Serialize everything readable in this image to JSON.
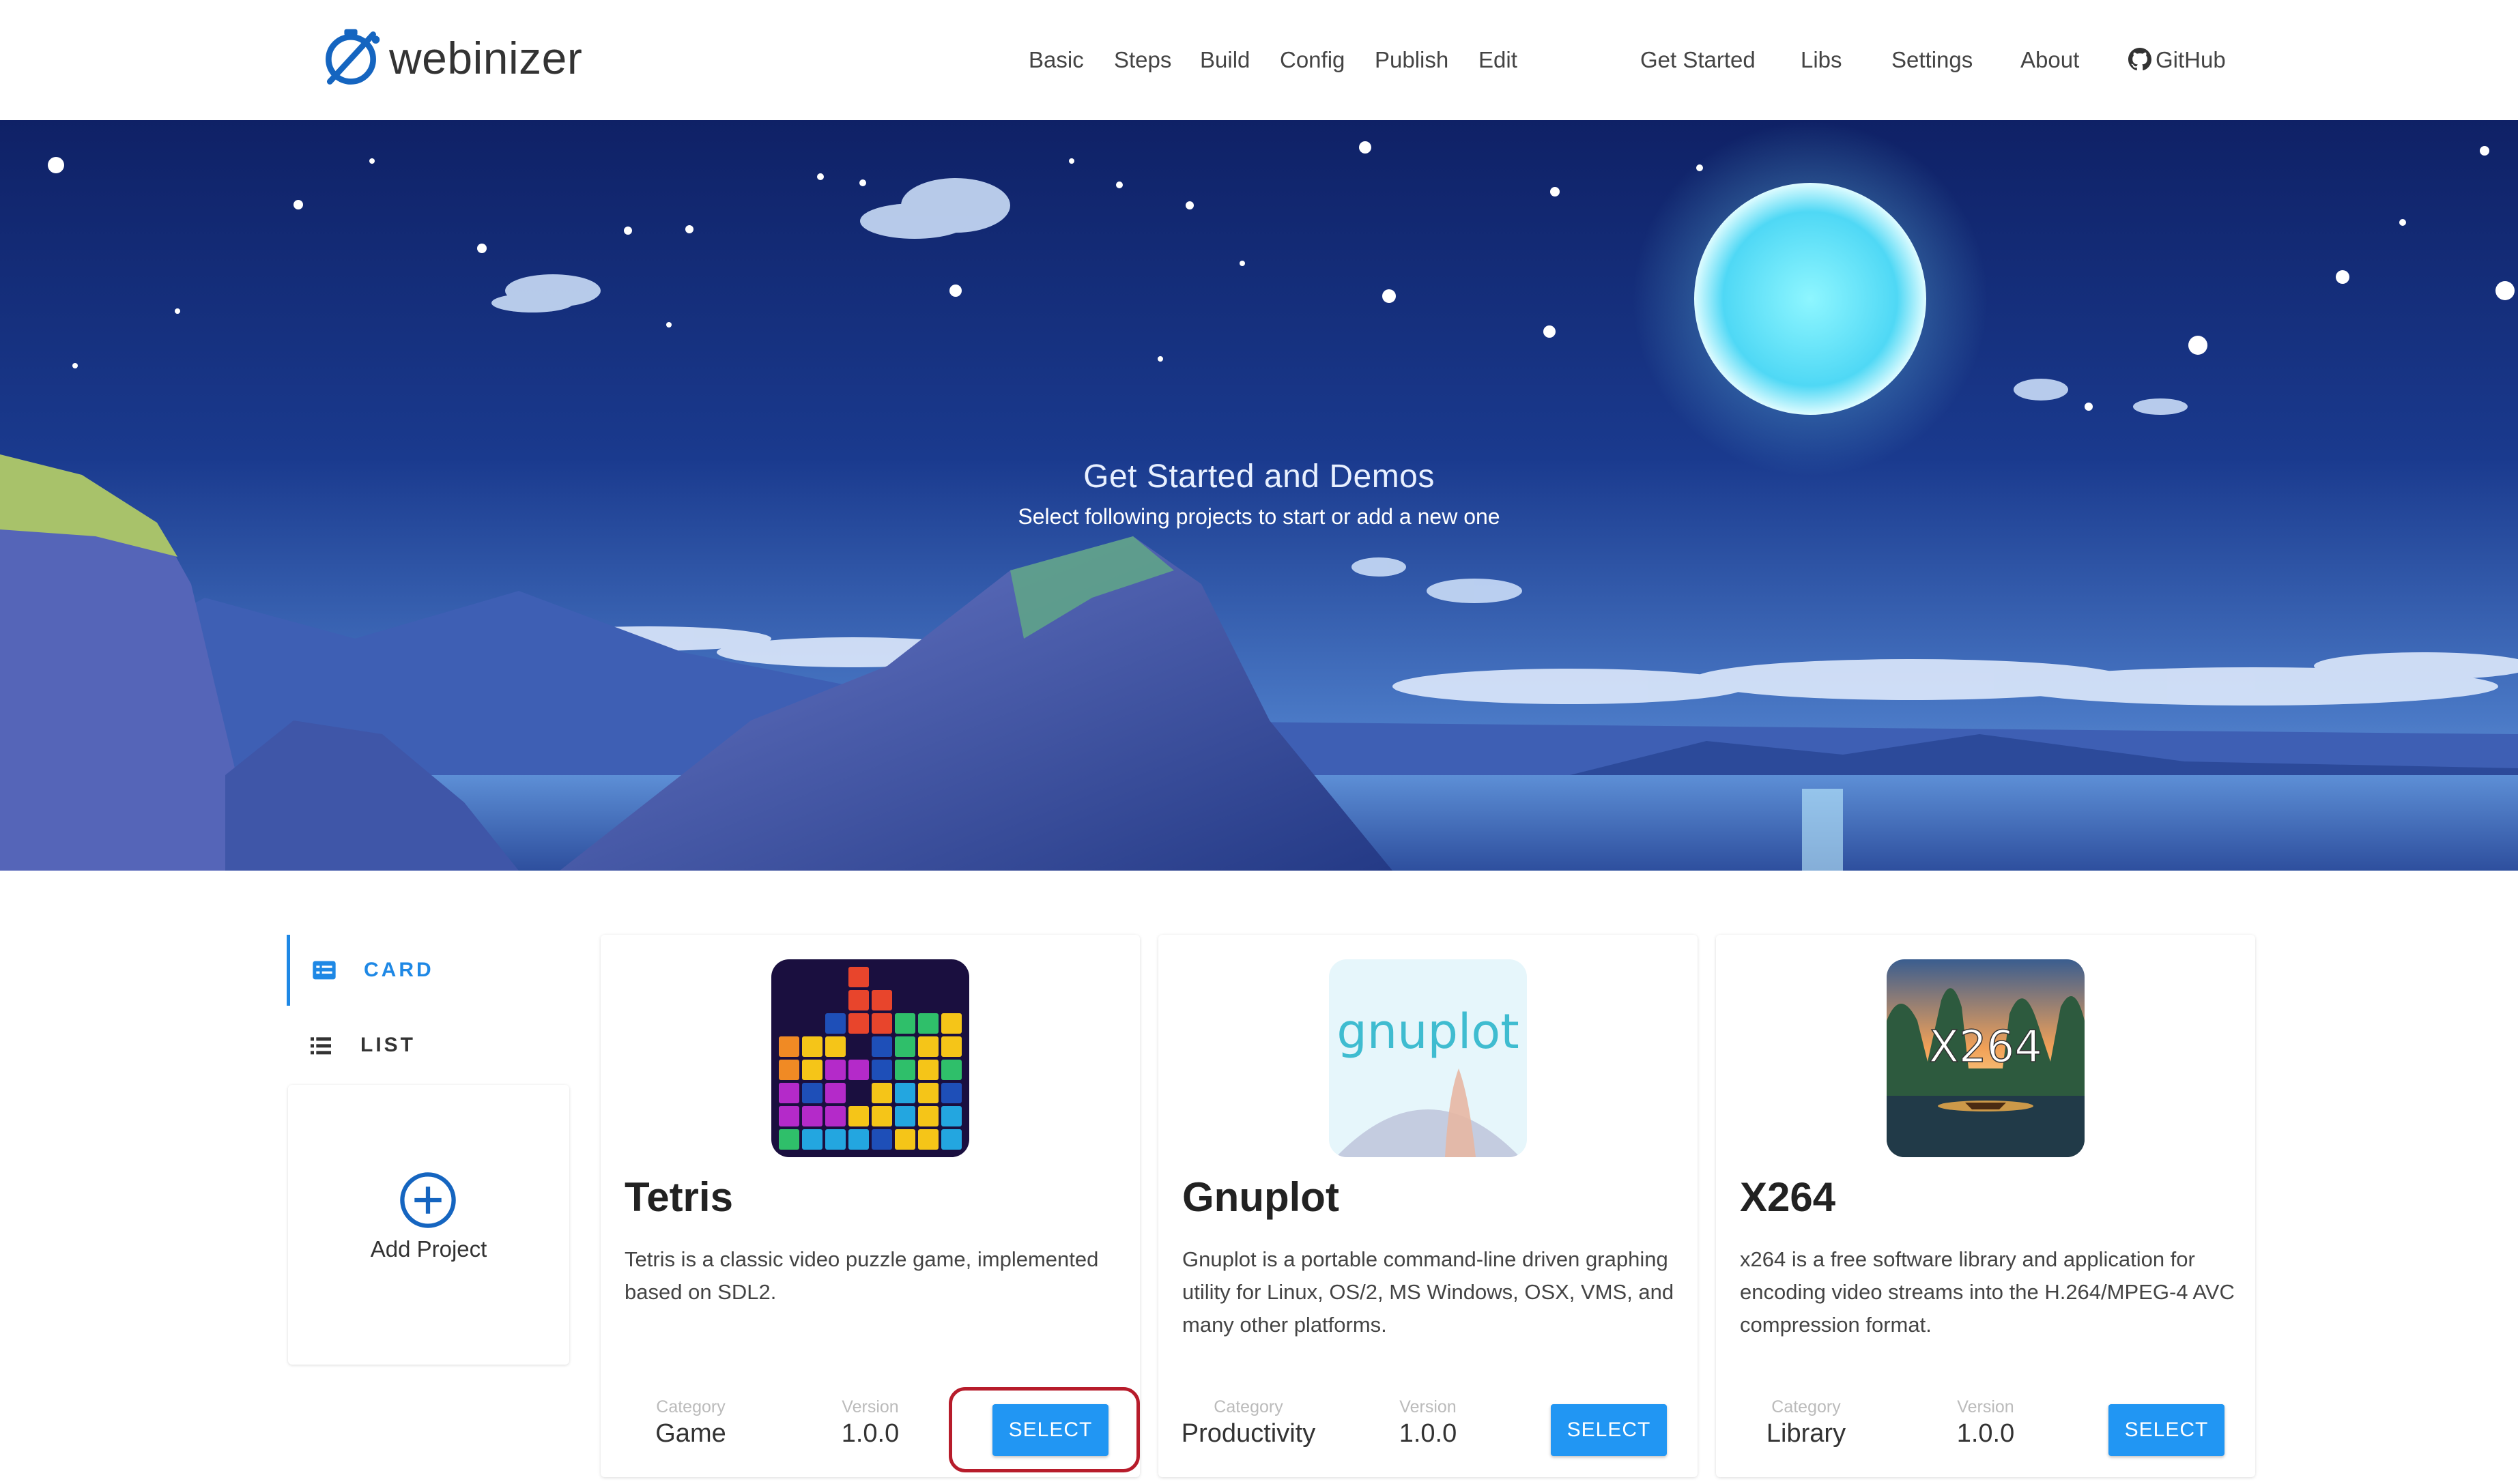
{
  "header": {
    "brand": "webinizer",
    "nav": [
      {
        "label": "Basic"
      },
      {
        "label": "Steps"
      },
      {
        "label": "Build"
      },
      {
        "label": "Config"
      },
      {
        "label": "Publish"
      },
      {
        "label": "Edit"
      },
      {
        "label": "Get Started"
      },
      {
        "label": "Libs"
      },
      {
        "label": "Settings"
      },
      {
        "label": "About"
      },
      {
        "label": "GitHub"
      }
    ]
  },
  "hero": {
    "title": "Get Started and Demos",
    "subtitle": "Select following projects to start or add a new one"
  },
  "views": {
    "card_label": "CARD",
    "list_label": "LIST",
    "active": "CARD"
  },
  "add_project": {
    "label": "Add Project"
  },
  "meta_labels": {
    "category": "Category",
    "version": "Version"
  },
  "projects": [
    {
      "name": "Tetris",
      "description": "Tetris is a classic video puzzle game, implemented based on SDL2.",
      "category": "Game",
      "version": "1.0.0",
      "button": "SELECT",
      "thumbnail": "tetris-blocks-image"
    },
    {
      "name": "Gnuplot",
      "description": "Gnuplot is a portable command-line driven graphing utility for Linux, OS/2, MS Windows, OSX, VMS, and many other platforms.",
      "category": "Productivity",
      "version": "1.0.0",
      "button": "SELECT",
      "thumbnail": "gnuplot-logo-image",
      "thumbnail_text": "gnuplot"
    },
    {
      "name": "X264",
      "description": "x264 is a free software library and application for encoding video streams into the H.264/MPEG-4 AVC compression format.",
      "category": "Library",
      "version": "1.0.0",
      "button": "SELECT",
      "thumbnail": "x264-landscape-image",
      "thumbnail_text": "X264"
    }
  ],
  "colors": {
    "accent": "#1e88e5",
    "button": "#2196f3",
    "highlight": "#b71c2b",
    "hero_sky": "#142a72"
  }
}
